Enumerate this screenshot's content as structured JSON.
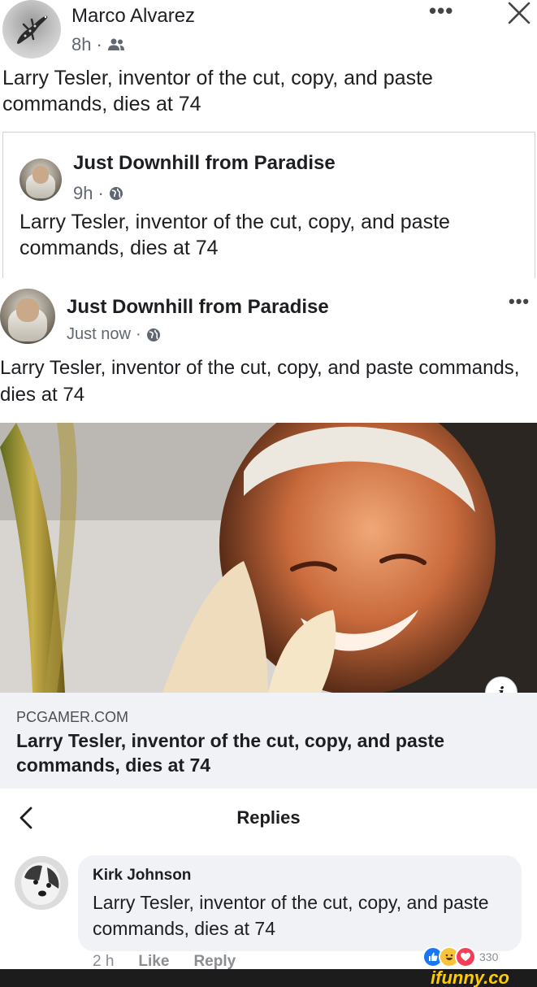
{
  "original_post": {
    "author": "Marco Alvarez",
    "time": "8h",
    "separator": "·",
    "audience_icon": "friends-icon",
    "text": "Larry Tesler, inventor of the cut, copy, and paste commands, dies at 74",
    "more_label": "•••",
    "close_label": "close-icon"
  },
  "shared_post": {
    "author": "Just Downhill from Paradise",
    "time": "9h",
    "separator": "·",
    "audience_icon": "globe-icon",
    "text": "Larry Tesler, inventor of the cut, copy, and paste commands, dies at 74"
  },
  "link_post": {
    "author": "Just Downhill from Paradise",
    "time": "Just now",
    "separator": "·",
    "audience_icon": "globe-icon",
    "more_label": "•••",
    "text": "Larry Tesler, inventor of the cut, copy, and paste commands, dies at 74",
    "link_card": {
      "domain": "PCGAMER.COM",
      "title": "Larry Tesler, inventor of the cut, copy, and paste commands, dies at 74",
      "info_label": "i"
    }
  },
  "replies": {
    "title": "Replies",
    "comment": {
      "author": "Kirk Johnson",
      "text": "Larry Tesler, inventor of the cut, copy, and paste commands, dies at 74",
      "time": "2 h",
      "like_label": "Like",
      "reply_label": "Reply",
      "reaction_count": "330"
    }
  },
  "watermark": "ifunny.co",
  "colors": {
    "text": "#1c1e21",
    "meta": "#606770",
    "card_bg": "#f0f2f5",
    "like": "#1877f2",
    "love": "#f33e58",
    "haha": "#f7c33b",
    "watermark": "#ffcc00"
  }
}
